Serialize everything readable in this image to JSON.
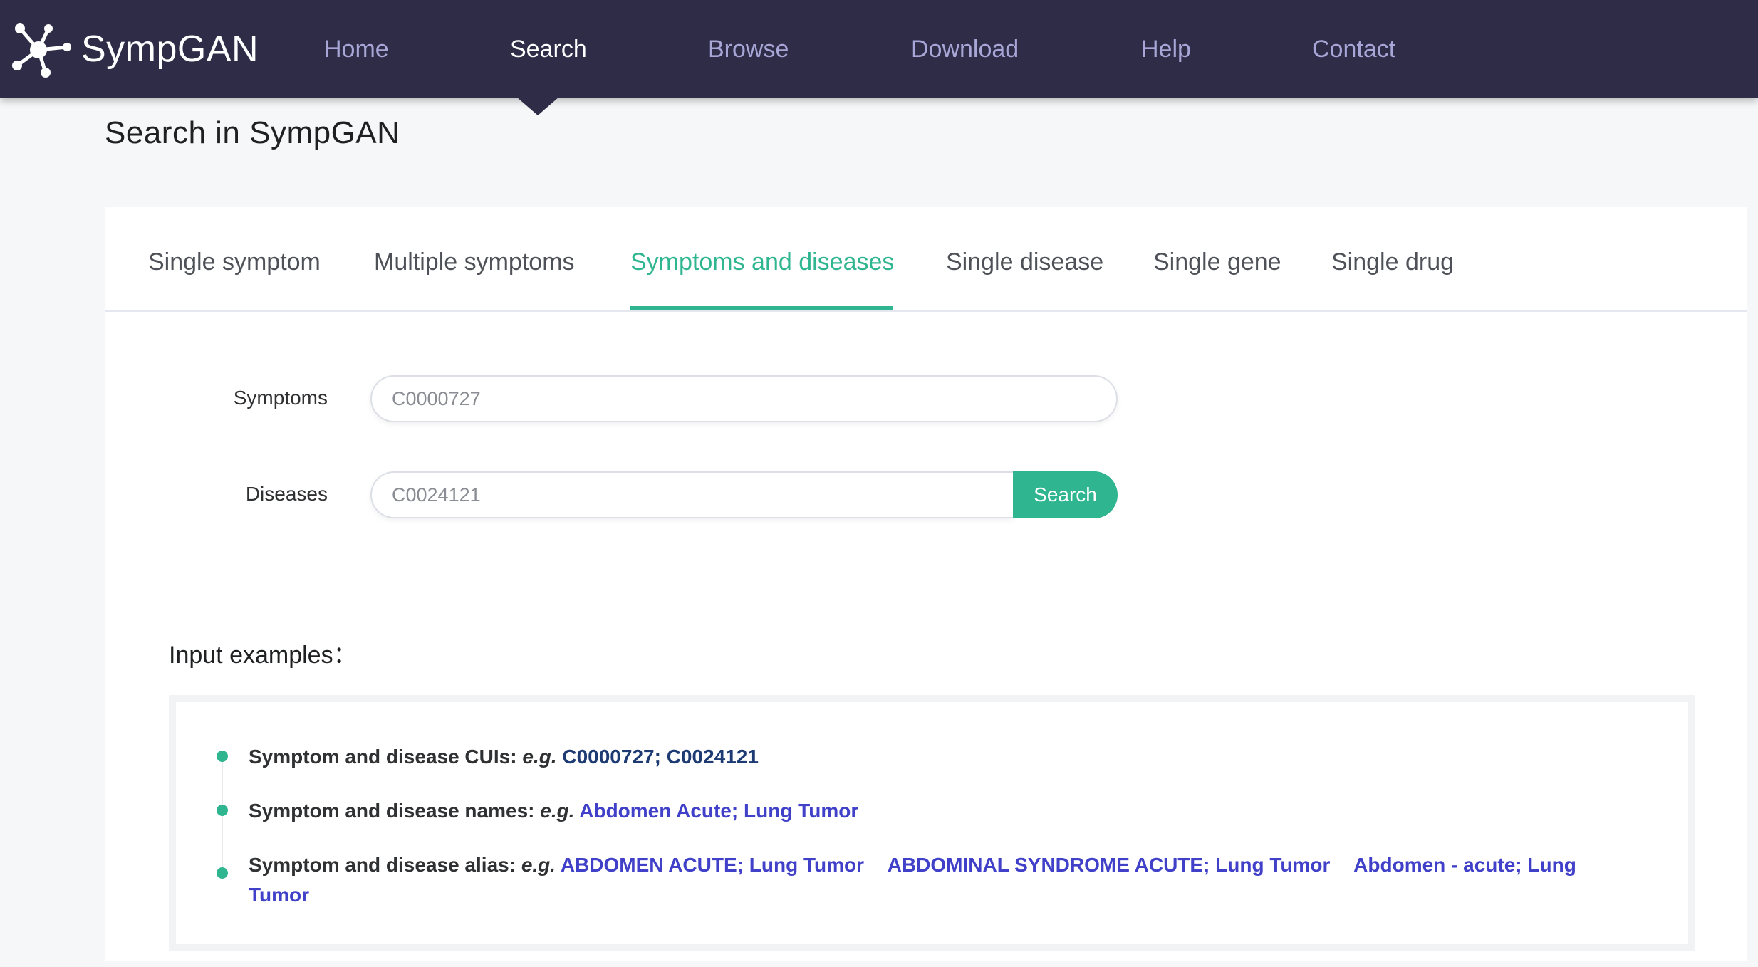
{
  "brand": {
    "name": "SympGAN"
  },
  "nav": {
    "items": [
      {
        "label": "Home",
        "active": false
      },
      {
        "label": "Search",
        "active": true
      },
      {
        "label": "Browse",
        "active": false
      },
      {
        "label": "Download",
        "active": false
      },
      {
        "label": "Help",
        "active": false
      },
      {
        "label": "Contact",
        "active": false
      }
    ]
  },
  "page": {
    "title": "Search in SympGAN"
  },
  "tabs": [
    {
      "label": "Single symptom",
      "active": false
    },
    {
      "label": "Multiple symptoms",
      "active": false
    },
    {
      "label": "Symptoms and diseases",
      "active": true
    },
    {
      "label": "Single disease",
      "active": false
    },
    {
      "label": "Single gene",
      "active": false
    },
    {
      "label": "Single drug",
      "active": false
    }
  ],
  "form": {
    "symptoms_label": "Symptoms",
    "symptoms_value": "C0000727",
    "diseases_label": "Diseases",
    "diseases_value": "C0024121",
    "search_label": "Search"
  },
  "examples": {
    "heading": "Input examples：",
    "eg": "e.g.",
    "rows": [
      {
        "label": "Symptom and disease CUIs:",
        "links": [
          "C0000727; C0024121"
        ]
      },
      {
        "label": "Symptom and disease names:",
        "links": [
          "Abdomen Acute; Lung Tumor"
        ]
      },
      {
        "label": "Symptom and disease alias:",
        "links": [
          "ABDOMEN ACUTE; Lung Tumor",
          "ABDOMINAL SYNDROME ACUTE; Lung Tumor",
          "Abdomen - acute; Lung Tumor"
        ]
      }
    ]
  },
  "colors": {
    "navbar": "#2e2c47",
    "nav_text": "#a7a6d6",
    "accent": "#2fb58f",
    "link": "#4040c9",
    "link_dark": "#1d3a73"
  },
  "icons": {
    "logo": "network-nodes-icon"
  }
}
